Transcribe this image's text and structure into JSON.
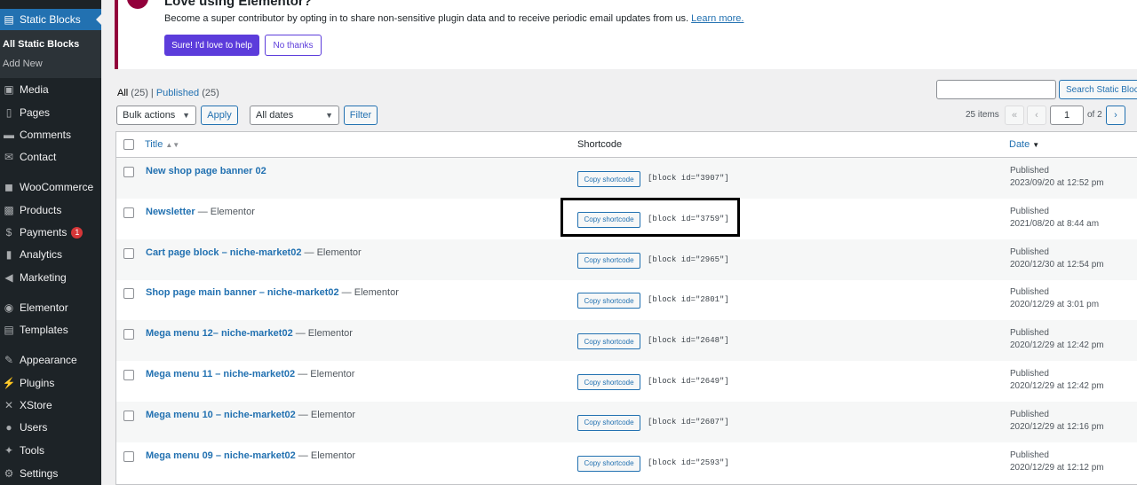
{
  "sidebar": {
    "items": [
      {
        "icon": "static-blocks-icon",
        "glyph": "▤",
        "label": "Static Blocks",
        "current": true
      },
      {
        "icon": "media-icon",
        "glyph": "▣",
        "label": "Media"
      },
      {
        "icon": "pages-icon",
        "glyph": "▯",
        "label": "Pages"
      },
      {
        "icon": "comments-icon",
        "glyph": "▬",
        "label": "Comments"
      },
      {
        "icon": "contact-icon",
        "glyph": "✉",
        "label": "Contact"
      },
      {
        "icon": "woocommerce-icon",
        "glyph": "◼",
        "label": "WooCommerce"
      },
      {
        "icon": "products-icon",
        "glyph": "▩",
        "label": "Products"
      },
      {
        "icon": "payments-icon",
        "glyph": "$",
        "label": "Payments",
        "badge": "1"
      },
      {
        "icon": "analytics-icon",
        "glyph": "▮",
        "label": "Analytics"
      },
      {
        "icon": "marketing-icon",
        "glyph": "◀",
        "label": "Marketing"
      },
      {
        "icon": "elementor-icon",
        "glyph": "◉",
        "label": "Elementor"
      },
      {
        "icon": "templates-icon",
        "glyph": "▤",
        "label": "Templates"
      },
      {
        "icon": "appearance-icon",
        "glyph": "✎",
        "label": "Appearance"
      },
      {
        "icon": "plugins-icon",
        "glyph": "⚡",
        "label": "Plugins"
      },
      {
        "icon": "xstore-icon",
        "glyph": "✕",
        "label": "XStore"
      },
      {
        "icon": "users-icon",
        "glyph": "●",
        "label": "Users"
      },
      {
        "icon": "tools-icon",
        "glyph": "✦",
        "label": "Tools"
      },
      {
        "icon": "settings-icon",
        "glyph": "⚙",
        "label": "Settings"
      }
    ],
    "submenu": [
      "All Static Blocks",
      "Add New"
    ]
  },
  "notice": {
    "title": "Love using Elementor?",
    "text": "Become a super contributor by opting in to share non-sensitive plugin data and to receive periodic email updates from us.",
    "learn_more": "Learn more.",
    "primary": "Sure! I'd love to help",
    "secondary": "No thanks"
  },
  "views": {
    "all": "All",
    "all_count": "(25)",
    "sep": "|",
    "published": "Published",
    "published_count": "(25)"
  },
  "toolbar": {
    "bulk": "Bulk actions",
    "apply": "Apply",
    "dates": "All dates",
    "filter": "Filter",
    "search_button": "Search Static Blocks",
    "items": "25 items",
    "first": "«",
    "prev": "‹",
    "page": "1",
    "of": "of 2",
    "next": "›"
  },
  "table": {
    "headers": {
      "title": "Title",
      "shortcode": "Shortcode",
      "date": "Date"
    },
    "copy_label": "Copy shortcode",
    "rows": [
      {
        "title": "New shop page banner 02",
        "suffix": "",
        "code": "[block id=\"3907\"]",
        "status": "Published",
        "date": "2023/09/20 at 12:52 pm"
      },
      {
        "title": "Newsletter",
        "suffix": " — Elementor",
        "code": "[block id=\"3759\"]",
        "status": "Published",
        "date": "2021/08/20 at 8:44 am"
      },
      {
        "title": "Cart page block – niche-market02",
        "suffix": " — Elementor",
        "code": "[block id=\"2965\"]",
        "status": "Published",
        "date": "2020/12/30 at 12:54 pm"
      },
      {
        "title": "Shop page main banner – niche-market02",
        "suffix": " — Elementor",
        "code": "[block id=\"2801\"]",
        "status": "Published",
        "date": "2020/12/29 at 3:01 pm"
      },
      {
        "title": "Mega menu 12– niche-market02",
        "suffix": " — Elementor",
        "code": "[block id=\"2648\"]",
        "status": "Published",
        "date": "2020/12/29 at 12:42 pm"
      },
      {
        "title": "Mega menu 11 – niche-market02",
        "suffix": " — Elementor",
        "code": "[block id=\"2649\"]",
        "status": "Published",
        "date": "2020/12/29 at 12:42 pm"
      },
      {
        "title": "Mega menu 10 – niche-market02",
        "suffix": " — Elementor",
        "code": "[block id=\"2607\"]",
        "status": "Published",
        "date": "2020/12/29 at 12:16 pm"
      },
      {
        "title": "Mega menu 09 – niche-market02",
        "suffix": " — Elementor",
        "code": "[block id=\"2593\"]",
        "status": "Published",
        "date": "2020/12/29 at 12:12 pm"
      }
    ]
  }
}
